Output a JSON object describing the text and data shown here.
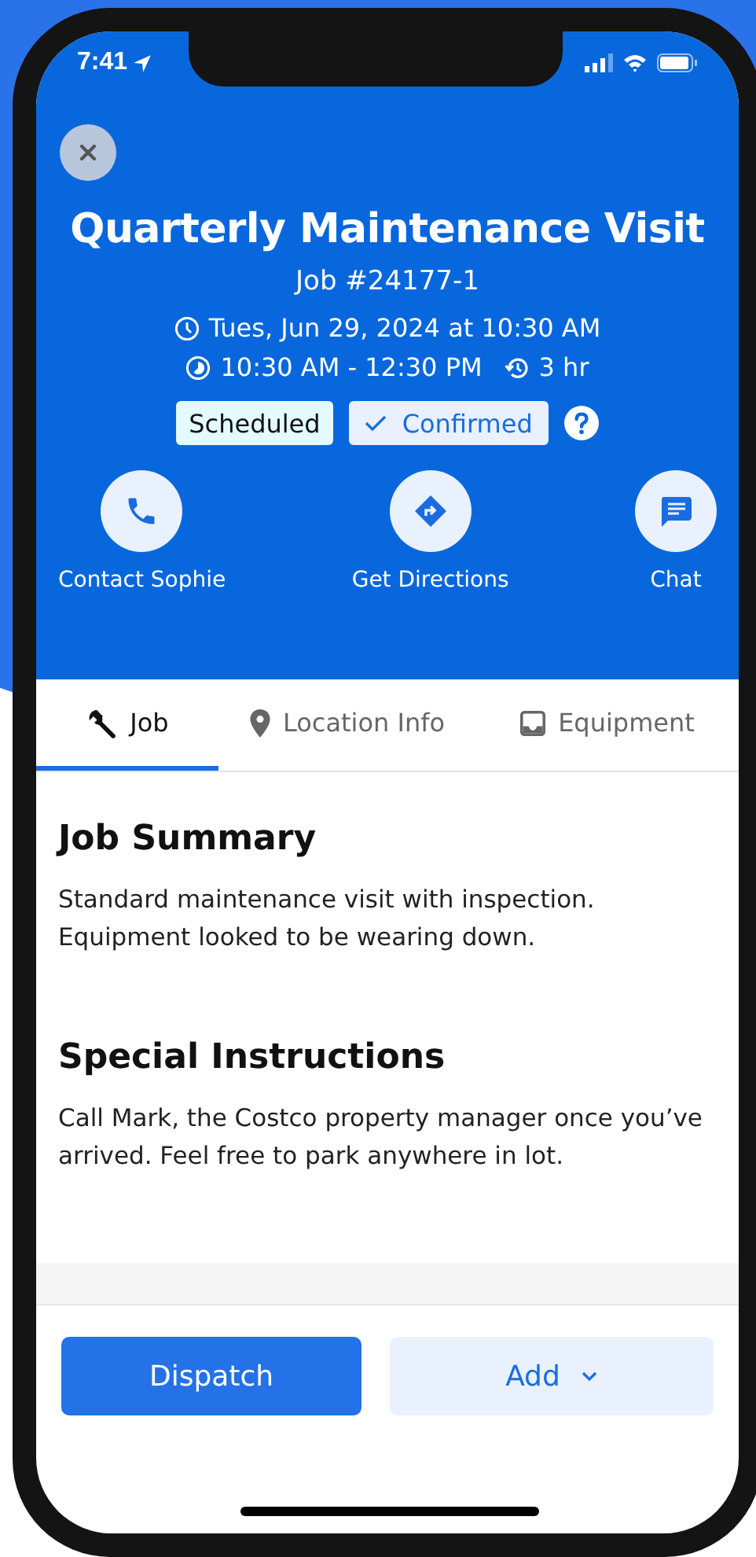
{
  "status_bar": {
    "time": "7:41"
  },
  "header": {
    "title": "Quarterly Maintenance Visit",
    "job_number": "Job #24177-1",
    "date": "Tues, Jun 29, 2024 at 10:30 AM",
    "time_range": "10:30 AM - 12:30 PM",
    "duration": "3 hr",
    "badges": [
      {
        "label": "Scheduled",
        "kind": "plain"
      },
      {
        "label": "Confirmed",
        "kind": "check"
      }
    ]
  },
  "actions": [
    {
      "label": "Contact Sophie",
      "kind": "phone"
    },
    {
      "label": "Get Directions",
      "kind": "directions"
    },
    {
      "label": "Chat",
      "kind": "chat"
    }
  ],
  "tabs": [
    {
      "label": "Job",
      "kind": "wrench",
      "selected": true
    },
    {
      "label": "Location Info",
      "kind": "pin",
      "selected": false
    },
    {
      "label": "Equipment",
      "kind": "tray",
      "selected": false
    }
  ],
  "sections": [
    {
      "heading": "Job Summary",
      "text": "Standard maintenance visit with inspection. Equipment looked to be wearing down."
    },
    {
      "heading": "Special Instructions",
      "text": "Call Mark, the Costco property manager once you’ve arrived. Feel free to park anywhere in lot."
    }
  ],
  "footer": [
    {
      "label": "Dispatch",
      "kind": "primary"
    },
    {
      "label": "Add",
      "kind": "dropdown"
    }
  ]
}
